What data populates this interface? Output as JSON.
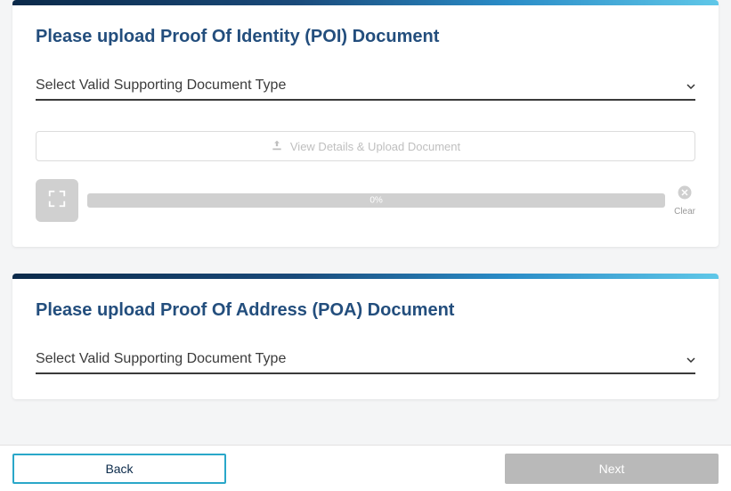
{
  "poi": {
    "title": "Please upload Proof Of Identity (POI) Document",
    "select_label": "Select Valid Supporting Document Type",
    "upload_label": "View Details & Upload Document",
    "progress_text": "0%",
    "clear_label": "Clear"
  },
  "poa": {
    "title": "Please upload Proof Of Address (POA) Document",
    "select_label": "Select Valid Supporting Document Type"
  },
  "footer": {
    "back_label": "Back",
    "next_label": "Next"
  }
}
